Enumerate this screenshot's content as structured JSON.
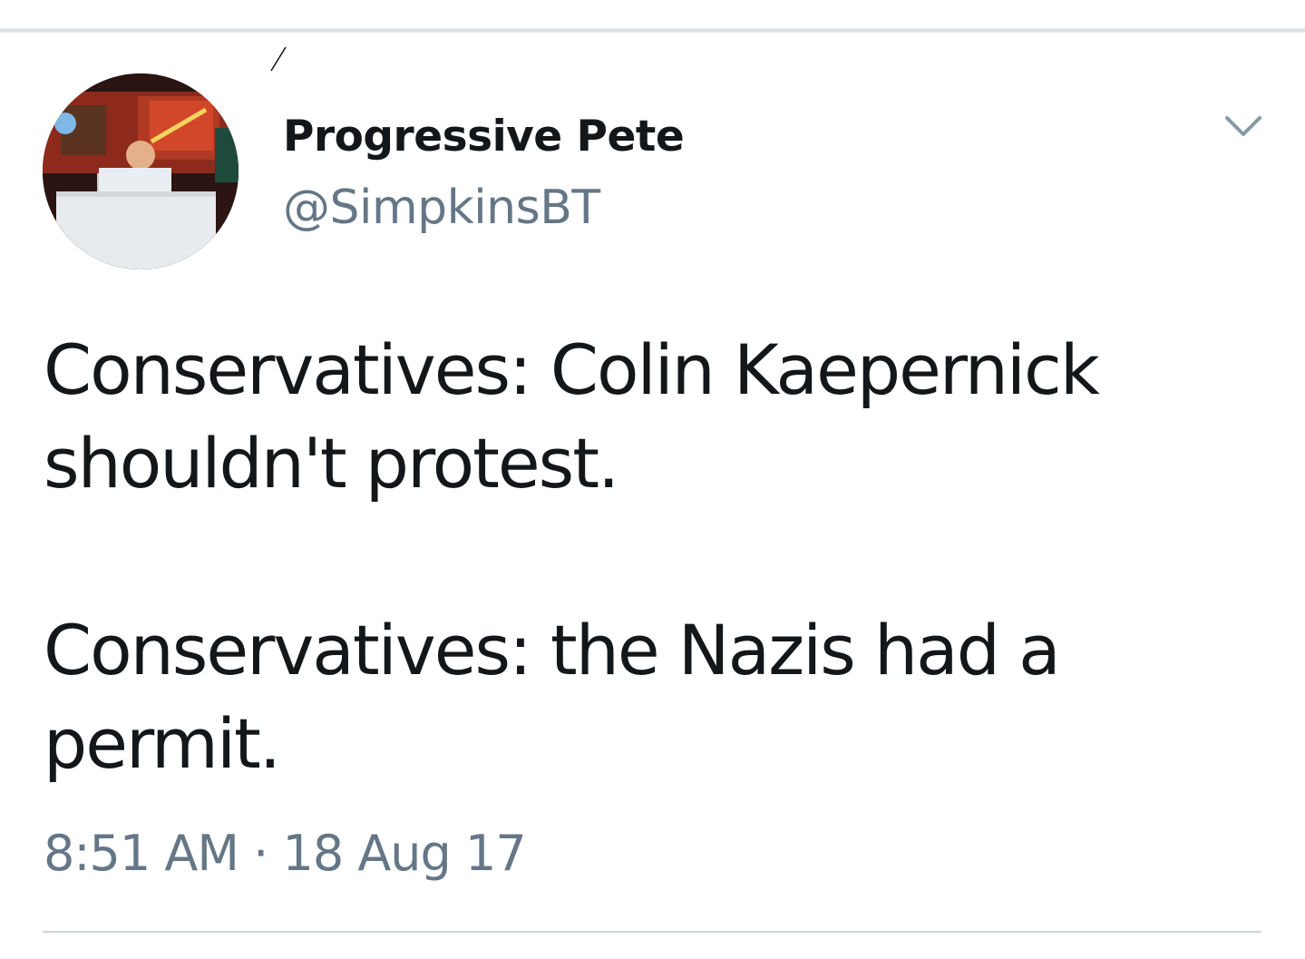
{
  "tweet": {
    "user": {
      "display_name": "Progressive Pete",
      "handle": "@SimpkinsBT"
    },
    "text_paragraphs": [
      "Conservatives: Colin Kaepernick shouldn't protest.",
      "Conservatives: the Nazis had a permit."
    ],
    "text_lines": [
      [
        "Conservatives: Colin Kaepernick",
        "shouldn't protest."
      ],
      [
        "Conservatives: the Nazis had a",
        "permit."
      ]
    ],
    "time": "8:51 AM",
    "separator": "·",
    "date": "18 Aug 17"
  },
  "icons": {
    "menu": "chevron-down-icon"
  },
  "colors": {
    "primary_text": "#14171a",
    "secondary_text": "#657786",
    "divider": "#ccd6dd",
    "background": "#ffffff"
  }
}
